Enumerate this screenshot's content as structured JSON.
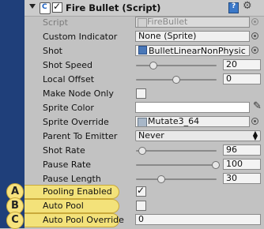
{
  "component": {
    "title": "Fire Bullet (Script)",
    "enabled": true
  },
  "rows": {
    "script": {
      "label": "Script",
      "value": "FireBullet"
    },
    "custom_indicator": {
      "label": "Custom Indicator",
      "value": "None (Sprite)"
    },
    "shot": {
      "label": "Shot",
      "value": "BulletLinearNonPhysic"
    },
    "shot_speed": {
      "label": "Shot Speed",
      "value": "20",
      "fraction": 0.2
    },
    "local_offset": {
      "label": "Local Offset",
      "value": "0",
      "fraction": 0.5
    },
    "make_node_only": {
      "label": "Make Node Only",
      "checked": false
    },
    "sprite_color": {
      "label": "Sprite Color",
      "color": "#ffffff"
    },
    "sprite_override": {
      "label": "Sprite Override",
      "value": "Mutate3_64"
    },
    "parent_to_emitter": {
      "label": "Parent To Emitter",
      "value": "Never"
    },
    "shot_rate": {
      "label": "Shot Rate",
      "value": "96",
      "fraction": 0.05
    },
    "pause_rate": {
      "label": "Pause Rate",
      "value": "100",
      "fraction": 1.0
    },
    "pause_length": {
      "label": "Pause Length",
      "value": "30",
      "fraction": 0.3
    },
    "pooling_enabled": {
      "label": "Pooling Enabled",
      "checked": true
    },
    "auto_pool": {
      "label": "Auto Pool",
      "checked": false
    },
    "auto_pool_override": {
      "label": "Auto Pool Override",
      "value": "0"
    }
  },
  "callouts": {
    "a": "A",
    "b": "B",
    "c": "C",
    "color": "#f3e27a"
  }
}
